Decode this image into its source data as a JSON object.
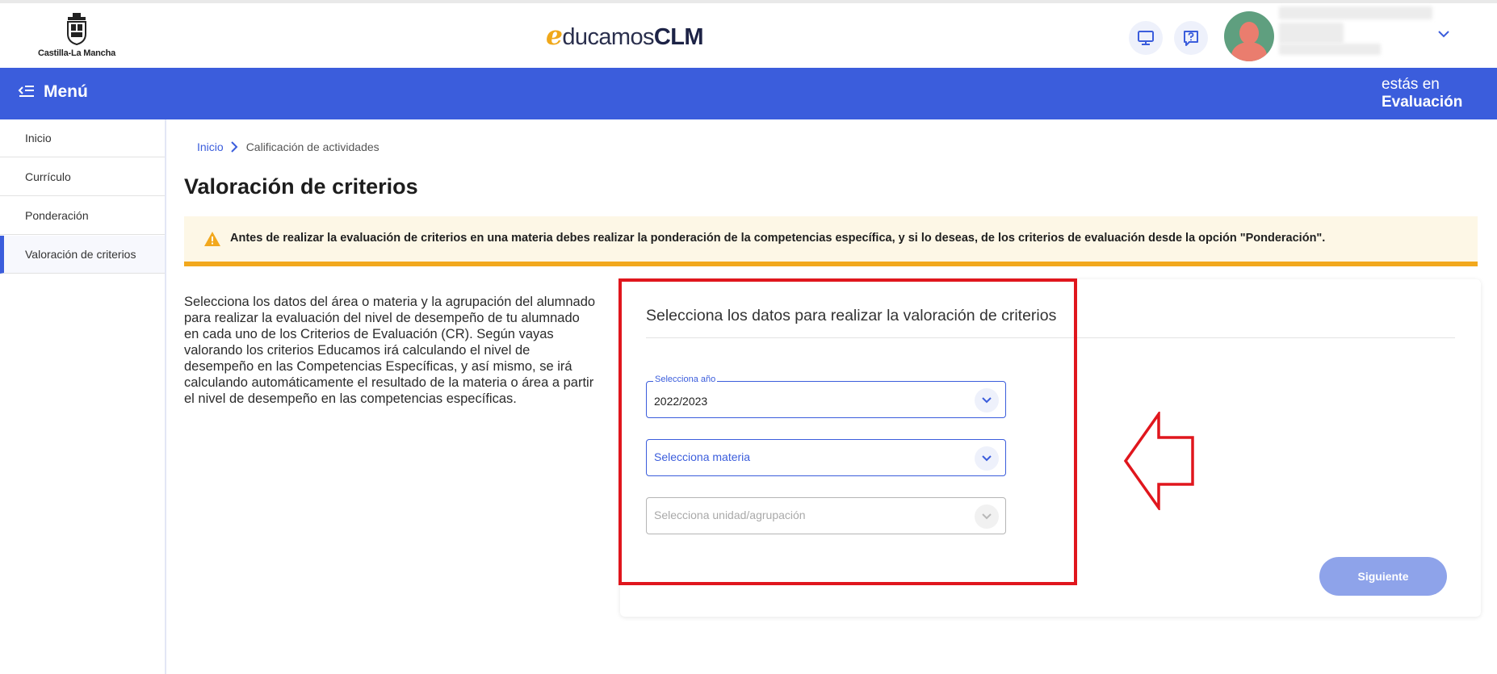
{
  "header": {
    "gov_logo_text": "Castilla-La Mancha",
    "brand": {
      "e": "e",
      "light": "ducamos",
      "bold": "CLM"
    },
    "icons": [
      "desktop-icon",
      "help-icon"
    ]
  },
  "menubar": {
    "menu_label": "Menú",
    "context_line1": "estás en",
    "context_line2": "Evaluación"
  },
  "sidebar": {
    "items": [
      {
        "label": "Inicio"
      },
      {
        "label": "Currículo"
      },
      {
        "label": "Ponderación"
      },
      {
        "label": "Valoración de criterios"
      }
    ]
  },
  "breadcrumb": {
    "home": "Inicio",
    "current": "Calificación de actividades"
  },
  "page": {
    "title": "Valoración de criterios",
    "alert": "Antes de realizar la evaluación de criterios en una materia debes realizar la ponderación de la competencias específica, y si lo deseas, de los criterios de evaluación desde la opción \"Ponderación\".",
    "intro": "Selecciona los datos del área o materia y la agrupación del alumnado para realizar la evaluación del nivel de desempeño de tu alumnado en cada uno de los Criterios de Evaluación (CR). Según vayas valorando los criterios Educamos irá calculando el nivel de desempeño en las Competencias Específicas, y así mismo, se irá calculando automáticamente el resultado de la materia o área a partir el nivel de desempeño en las competencias específicas."
  },
  "form": {
    "title": "Selecciona los datos para realizar la valoración de criterios",
    "year": {
      "label": "Selecciona año",
      "value": "2022/2023"
    },
    "subject": {
      "placeholder": "Selecciona materia"
    },
    "group": {
      "placeholder": "Selecciona unidad/agrupación"
    },
    "next_label": "Siguiente"
  },
  "colors": {
    "primary": "#3b5ddc",
    "warning": "#f2a81d",
    "highlight": "#e0161d"
  }
}
